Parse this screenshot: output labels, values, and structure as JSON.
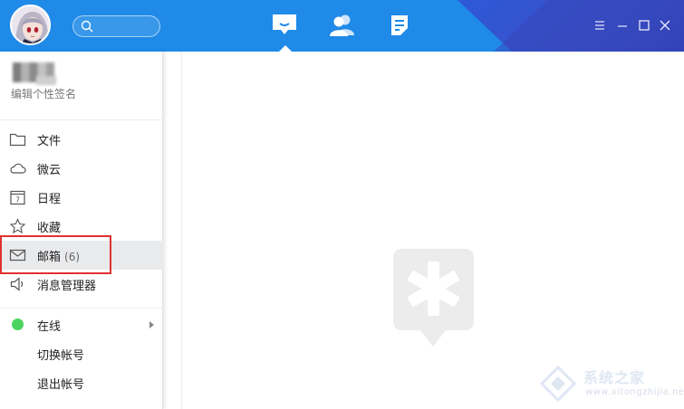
{
  "window": {
    "tabs": [
      {
        "name": "messages",
        "icon": "chat-bubble-icon",
        "active": true
      },
      {
        "name": "contacts",
        "icon": "contacts-icon",
        "active": false
      },
      {
        "name": "space",
        "icon": "space-icon",
        "active": false
      }
    ],
    "controls": [
      "menu-icon",
      "minimize-icon",
      "maximize-icon",
      "close-icon"
    ],
    "accent": "#1f8ae8"
  },
  "search": {
    "placeholder": ""
  },
  "profile": {
    "signature_placeholder": "编辑个性签名"
  },
  "menu": [
    {
      "key": "files",
      "label": "文件",
      "icon": "folder-icon"
    },
    {
      "key": "weiyun",
      "label": "微云",
      "icon": "cloud-icon"
    },
    {
      "key": "schedule",
      "label": "日程",
      "icon": "calendar-icon",
      "icon_text": "7"
    },
    {
      "key": "favorites",
      "label": "收藏",
      "icon": "star-icon"
    },
    {
      "key": "mailbox",
      "label": "邮箱",
      "count": "(6)",
      "icon": "mail-icon",
      "highlighted": true
    },
    {
      "key": "msg_manager",
      "label": "消息管理器",
      "icon": "speaker-icon"
    }
  ],
  "status": [
    {
      "key": "online",
      "label": "在线",
      "color": "#4bd462",
      "has_submenu": true
    },
    {
      "key": "switch_account",
      "label": "切换帐号"
    },
    {
      "key": "logout",
      "label": "退出帐号"
    }
  ],
  "highlight_color": "#e0312f",
  "watermark": {
    "brand": "系统之家",
    "url": "www.xitongzhijia.net"
  }
}
